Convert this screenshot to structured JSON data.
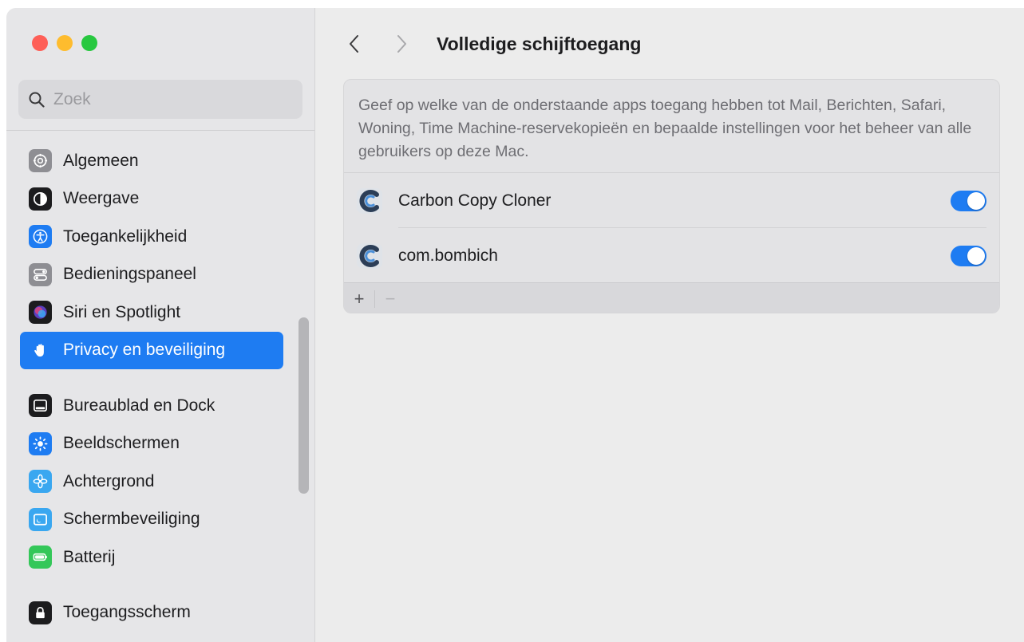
{
  "window": {
    "title": "Volledige schijftoegang"
  },
  "sidebar": {
    "search_placeholder": "Zoek",
    "items": [
      {
        "label": "Algemeen",
        "icon": "gear-icon",
        "color": "#8e8e93"
      },
      {
        "label": "Weergave",
        "icon": "appearance-icon",
        "color": "#1c1c1e"
      },
      {
        "label": "Toegankelijkheid",
        "icon": "accessibility-icon",
        "color": "#1e7cf2"
      },
      {
        "label": "Bedieningspaneel",
        "icon": "control-center-icon",
        "color": "#8e8e93"
      },
      {
        "label": "Siri en Spotlight",
        "icon": "siri-icon",
        "color": "#5a3fc0"
      },
      {
        "label": "Privacy en beveiliging",
        "icon": "hand-icon",
        "color": "#1e7cf2",
        "active": true
      },
      {
        "label": "Bureaublad en Dock",
        "icon": "dock-icon",
        "color": "#1c1c1e"
      },
      {
        "label": "Beeldschermen",
        "icon": "brightness-icon",
        "color": "#1e7cf2"
      },
      {
        "label": "Achtergrond",
        "icon": "flower-icon",
        "color": "#3aa7f0"
      },
      {
        "label": "Schermbeveiliging",
        "icon": "screensaver-icon",
        "color": "#3aa7f0"
      },
      {
        "label": "Batterij",
        "icon": "battery-icon",
        "color": "#34c759"
      },
      {
        "label": "Toegangsscherm",
        "icon": "lock-icon",
        "color": "#1c1c1e"
      }
    ]
  },
  "main": {
    "title": "Volledige schijftoegang",
    "description": "Geef op welke van de onderstaande apps toegang hebben tot Mail, Berichten, Safari, Woning, Time Machine-reservekopieën en bepaalde instellingen voor het beheer van alle gebruikers op deze Mac.",
    "apps": [
      {
        "name": "Carbon Copy Cloner",
        "enabled": true
      },
      {
        "name": "com.bombich",
        "enabled": true
      }
    ],
    "add_label": "+",
    "remove_label": "−"
  },
  "colors": {
    "accent": "#1e7cf2",
    "close": "#fe5f57",
    "minimize": "#febc2e",
    "zoom": "#28c840"
  }
}
